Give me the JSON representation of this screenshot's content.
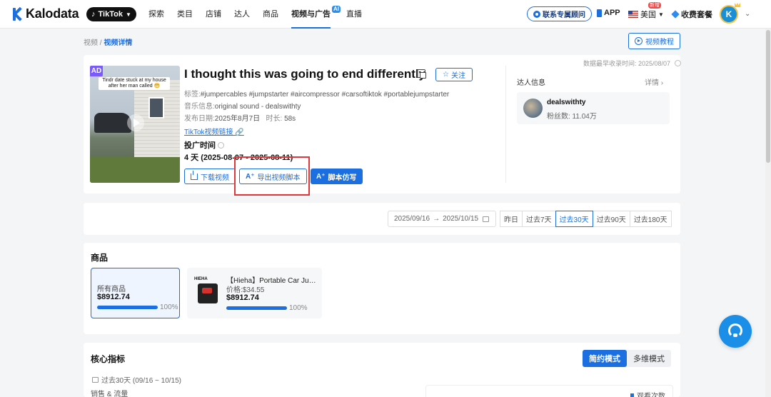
{
  "header": {
    "logo": "Kalodata",
    "platform": "TikTok",
    "nav": [
      "探索",
      "类目",
      "店铺",
      "达人",
      "商品",
      "视频与广告",
      "直播"
    ],
    "nav_ai_badge": "AI",
    "contact": "联系专属顾问",
    "app": "APP",
    "region": "美国",
    "new_badge": "新增",
    "plan": "收费套餐",
    "avatar_initial": "K"
  },
  "breadcrumb": {
    "root": "视频",
    "separator": "/",
    "current": "视频详情"
  },
  "tutorial": "视频教程",
  "video": {
    "collect_time": "数据最早收录时间: 2025/08/07",
    "ad_tag": "AD",
    "thumb_caption": "Tindr date stuck at my house after her man called 😬",
    "title": "I thought this was going to end differently",
    "follow": "关注",
    "tags_label": "标签:",
    "tags": "#jumpercables #jumpstarter #aircompressor #carsoftiktok #portablejumpstarter",
    "music_label": "音乐信息:",
    "music": "original sound - dealswithty",
    "publish_label": "发布日期:",
    "publish": "2025年8月7日",
    "duration_label": "时长:",
    "duration": "58s",
    "tiktok_link": "TikTok视频链接",
    "promo_label": "投广时间",
    "promo_value": "4 天 (2025-08-07 - 2025-08-11)",
    "download": "下载视频",
    "export_script": "导出视频脚本",
    "imitate_script": "脚本仿写"
  },
  "creator": {
    "title": "达人信息",
    "detail": "详情",
    "name": "dealswithty",
    "fans": "粉丝数: 11.04万"
  },
  "filter": {
    "date_from": "2025/09/16",
    "arrow": "→",
    "date_to": "2025/10/15",
    "ranges": [
      "昨日",
      "过去7天",
      "过去30天",
      "过去90天",
      "过去180天"
    ],
    "active_range": "过去30天"
  },
  "products": {
    "title": "商品",
    "all_label": "所有商品",
    "all_amount": "$8912.74",
    "all_pct": "100%",
    "all_share": 1.0,
    "item_brand": "HIEHA",
    "item_name": "【Hieha】Portable Car Jump Starter",
    "item_price": "价格:$34.55",
    "item_amount": "$8912.74",
    "item_pct": "100%",
    "item_share": 1.0
  },
  "metrics": {
    "title": "核心指标",
    "modes": [
      "简约模式",
      "多维模式"
    ],
    "active_mode": "简约模式",
    "period": "过去30天 (09/16 ~ 10/15)",
    "sales_traffic": "销售 & 流量",
    "legend_views": "观看次数"
  },
  "colors": {
    "accent": "#1b6fe0",
    "highlight": "#e2373a",
    "ad": "#7a5af8"
  }
}
